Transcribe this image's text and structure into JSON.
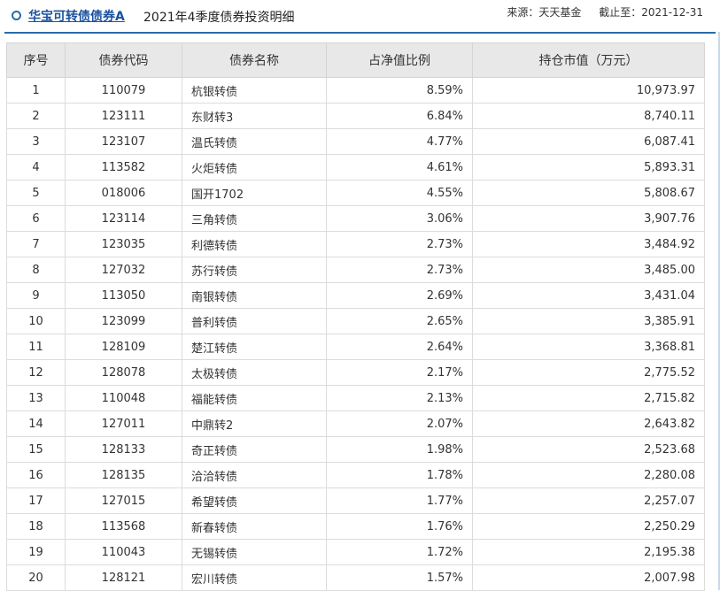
{
  "header": {
    "fund_name": "华宝可转债债券A",
    "report_title": "2021年4季度债券投资明细",
    "source": "来源：天天基金",
    "cutoff": "截止至：2021-12-31"
  },
  "table": {
    "columns": [
      "序号",
      "债券代码",
      "债券名称",
      "占净值比例",
      "持仓市值（万元）"
    ],
    "rows": [
      [
        "1",
        "110079",
        "杭银转债",
        "8.59%",
        "10,973.97"
      ],
      [
        "2",
        "123111",
        "东财转3",
        "6.84%",
        "8,740.11"
      ],
      [
        "3",
        "123107",
        "温氏转债",
        "4.77%",
        "6,087.41"
      ],
      [
        "4",
        "113582",
        "火炬转债",
        "4.61%",
        "5,893.31"
      ],
      [
        "5",
        "018006",
        "国开1702",
        "4.55%",
        "5,808.67"
      ],
      [
        "6",
        "123114",
        "三角转债",
        "3.06%",
        "3,907.76"
      ],
      [
        "7",
        "123035",
        "利德转债",
        "2.73%",
        "3,484.92"
      ],
      [
        "8",
        "127032",
        "苏行转债",
        "2.73%",
        "3,485.00"
      ],
      [
        "9",
        "113050",
        "南银转债",
        "2.69%",
        "3,431.04"
      ],
      [
        "10",
        "123099",
        "普利转债",
        "2.65%",
        "3,385.91"
      ],
      [
        "11",
        "128109",
        "楚江转债",
        "2.64%",
        "3,368.81"
      ],
      [
        "12",
        "128078",
        "太极转债",
        "2.17%",
        "2,775.52"
      ],
      [
        "13",
        "110048",
        "福能转债",
        "2.13%",
        "2,715.82"
      ],
      [
        "14",
        "127011",
        "中鼎转2",
        "2.07%",
        "2,643.82"
      ],
      [
        "15",
        "128133",
        "奇正转债",
        "1.98%",
        "2,523.68"
      ],
      [
        "16",
        "128135",
        "洽洽转债",
        "1.78%",
        "2,280.08"
      ],
      [
        "17",
        "127015",
        "希望转债",
        "1.77%",
        "2,257.07"
      ],
      [
        "18",
        "113568",
        "新春转债",
        "1.76%",
        "2,250.29"
      ],
      [
        "19",
        "110043",
        "无锡转债",
        "1.72%",
        "2,195.38"
      ],
      [
        "20",
        "128121",
        "宏川转债",
        "1.57%",
        "2,007.98"
      ]
    ]
  }
}
